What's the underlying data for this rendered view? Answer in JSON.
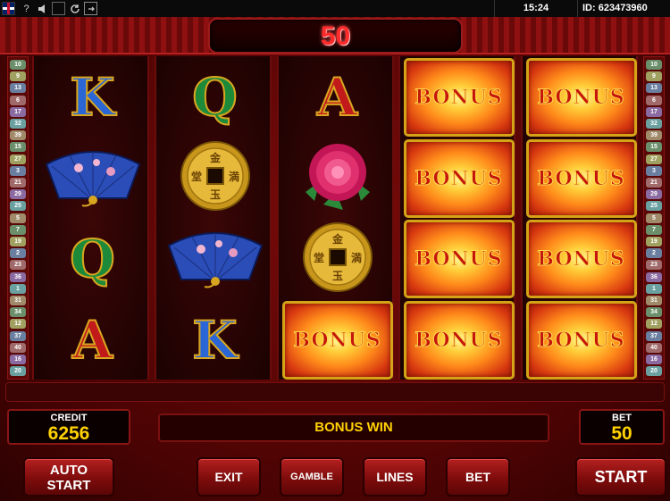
{
  "topbar": {
    "icons": [
      "uk-flag-icon",
      "help-icon",
      "sound-icon",
      "fullscreen-icon",
      "refresh-icon",
      "exit-icon"
    ],
    "help_glyph": "?",
    "time": "15:24",
    "id_text": "ID: 623473960"
  },
  "win_counter": "50",
  "line_numbers": {
    "left": [
      "10",
      "9",
      "13",
      "6",
      "17",
      "32",
      "39",
      "15",
      "27",
      "3",
      "21",
      "29",
      "25",
      "5",
      "7",
      "19",
      "2",
      "23",
      "36",
      "1",
      "31",
      "34",
      "12",
      "37",
      "40",
      "16",
      "20"
    ],
    "right": [
      "10",
      "9",
      "13",
      "6",
      "17",
      "32",
      "39",
      "15",
      "27",
      "3",
      "21",
      "29",
      "25",
      "5",
      "7",
      "19",
      "2",
      "23",
      "36",
      "1",
      "31",
      "34",
      "12",
      "37",
      "40",
      "16",
      "20"
    ]
  },
  "reels": [
    [
      "K",
      "fan",
      "Q",
      "A"
    ],
    [
      "Q",
      "coin",
      "fan",
      "K"
    ],
    [
      "A",
      "flower",
      "coin",
      "BONUS"
    ],
    [
      "BONUS",
      "BONUS",
      "BONUS",
      "BONUS"
    ],
    [
      "BONUS",
      "BONUS",
      "BONUS",
      "BONUS"
    ]
  ],
  "credit": {
    "label": "CREDIT",
    "value": "6256"
  },
  "message": "BONUS WIN",
  "bet": {
    "label": "BET",
    "value": "50"
  },
  "buttons": {
    "auto_start_1": "AUTO",
    "auto_start_2": "START",
    "exit": "EXIT",
    "gamble": "GAMBLE",
    "lines": "LINES",
    "bet": "BET",
    "start": "START"
  },
  "colors": {
    "frame_red": "#7a0a0a",
    "counter_red": "#ff2b2b",
    "value_yellow": "#ffd200",
    "gold": "#d4a317"
  }
}
